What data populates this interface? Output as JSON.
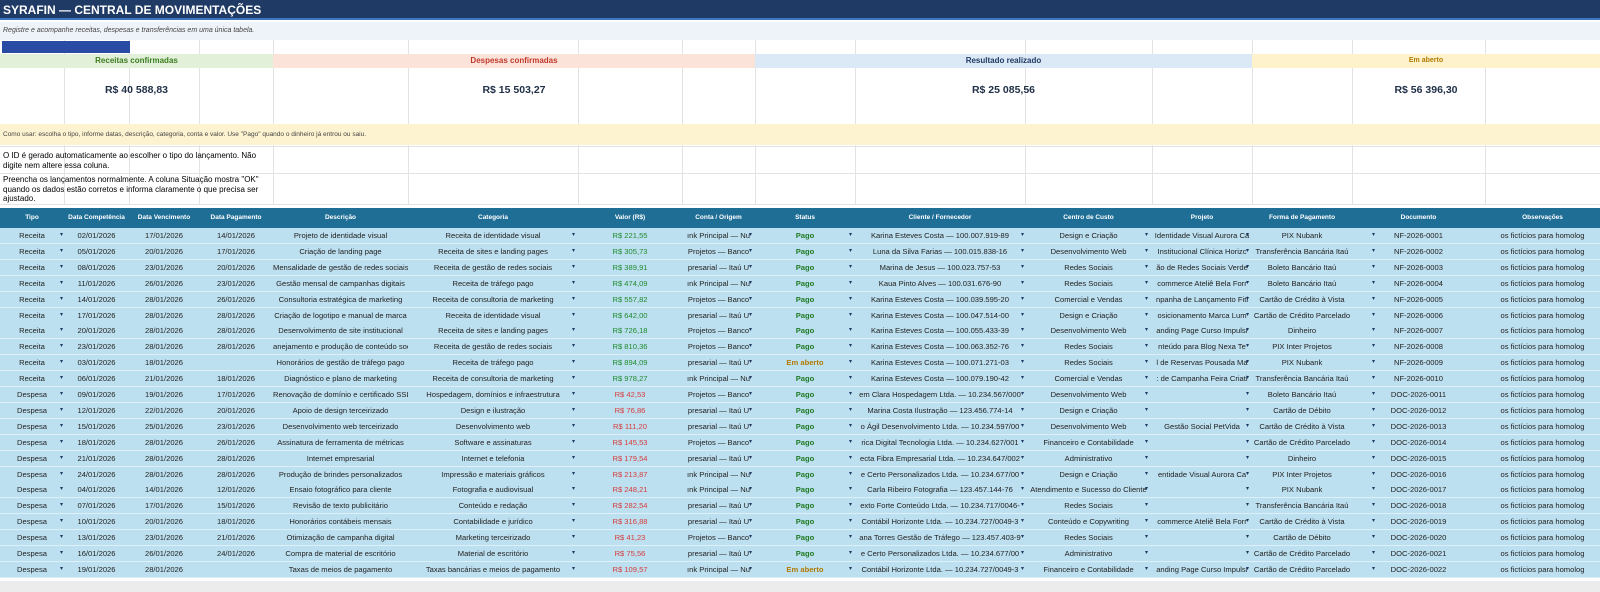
{
  "title": "SYRAFIN — CENTRAL DE MOVIMENTAÇÕES",
  "subtitle": "Registre e acompanhe receitas, despesas e transferências em uma única tabela.",
  "kpis": [
    {
      "label": "Receitas confirmadas",
      "value": "R$ 40 588,83",
      "bg": "#e2f0d9",
      "color": "#3a7d1e"
    },
    {
      "label": "Despesas confirmadas",
      "value": "R$ 15 503,27",
      "bg": "#fbe3da",
      "color": "#c0392b"
    },
    {
      "label": "Resultado realizado",
      "value": "R$ 25 085,56",
      "bg": "#dbe8f5",
      "color": "#1f3a64"
    },
    {
      "label": "Em aberto",
      "value": "R$ 56 396,30",
      "bg": "#fdf2cc",
      "color": "#b07b00"
    }
  ],
  "note": "Como usar: escolha o tipo, informe datas, descrição, categoria, conta e valor. Use \"Pago\" quando o dinheiro já entrou ou saiu.",
  "help1": "O ID é gerado automaticamente ao escolher o tipo do lançamento. Não digite nem altere essa coluna.",
  "help2": "Preencha os lançamentos normalmente. A coluna Situação mostra \"OK\" quando os dados estão corretos e informa claramente o que precisa ser ajustado.",
  "headers": [
    "Tipo",
    "Data Competência",
    "Data Vencimento",
    "Data Pagamento",
    "Descrição",
    "Categoria",
    "Valor (R$)",
    "Conta / Origem",
    "Status",
    "Cliente / Fornecedor",
    "Centro de Custo",
    "Projeto",
    "Forma de Pagamento",
    "Documento",
    "Observações"
  ],
  "rows": [
    [
      "Receita",
      "02/01/2026",
      "17/01/2026",
      "14/01/2026",
      "Projeto de identidade visual",
      "Receita de identidade visual",
      "R$ 221,55",
      "ınk Principal — Nu",
      "Pago",
      "Karina Esteves Costa — 100.007.919-89",
      "Design e Criação",
      "Identidade Visual Aurora Ca",
      "PIX Nubank",
      "NF-2026-0001",
      "os fictícios para homolog"
    ],
    [
      "Receita",
      "05/01/2026",
      "20/01/2026",
      "17/01/2026",
      "Criação de landing page",
      "Receita de sites e landing pages",
      "R$ 305,73",
      "Projetos — Banco",
      "Pago",
      "Luna da Silva Farias — 100.015.838-16",
      "Desenvolvimento Web",
      "Institucional Clínica Horizc",
      "Transferência Bancária Itaú",
      "NF-2026-0002",
      "os fictícios para homolog"
    ],
    [
      "Receita",
      "08/01/2026",
      "23/01/2026",
      "20/01/2026",
      "Mensalidade de gestão de redes sociais",
      "Receita de gestão de redes sociais",
      "R$ 389,91",
      "presarial — Itaú U",
      "Pago",
      "Marina de Jesus — 100.023.757-53",
      "Redes Sociais",
      "ão de Redes Sociais Verde",
      "Boleto Bancário Itaú",
      "NF-2026-0003",
      "os fictícios para homolog"
    ],
    [
      "Receita",
      "11/01/2026",
      "26/01/2026",
      "23/01/2026",
      "Gestão mensal de campanhas digitais",
      "Receita de tráfego pago",
      "R$ 474,09",
      "ınk Principal — Nu",
      "Pago",
      "Kaua Pinto Alves — 100.031.676-90",
      "Redes Sociais",
      "commerce Ateliê Bela Forr",
      "Boleto Bancário Itaú",
      "NF-2026-0004",
      "os fictícios para homolog"
    ],
    [
      "Receita",
      "14/01/2026",
      "28/01/2026",
      "26/01/2026",
      "Consultoria estratégica de marketing",
      "Receita de consultoria de marketing",
      "R$ 557,82",
      "Projetos — Banco",
      "Pago",
      "Karina Esteves Costa — 100.039.595-20",
      "Comercial e Vendas",
      "npanha de Lançamento Fitl",
      "Cartão de Crédito à Vista",
      "NF-2026-0005",
      "os fictícios para homolog"
    ],
    [
      "Receita",
      "17/01/2026",
      "28/01/2026",
      "28/01/2026",
      "Criação de logotipo e manual de marca",
      "Receita de identidade visual",
      "R$ 642,00",
      "presarial — Itaú U",
      "Pago",
      "Karina Esteves Costa — 100.047.514-00",
      "Design e Criação",
      "osicionamento Marca Lum",
      "Cartão de Crédito Parcelado",
      "NF-2026-0006",
      "os fictícios para homolog"
    ],
    [
      "Receita",
      "20/01/2026",
      "28/01/2026",
      "28/01/2026",
      "Desenvolvimento de site institucional",
      "Receita de sites e landing pages",
      "R$ 726,18",
      "Projetos — Banco",
      "Pago",
      "Karina Esteves Costa — 100.055.433-39",
      "Desenvolvimento Web",
      "anding Page Curso Impulsı",
      "Dinheiro",
      "NF-2026-0007",
      "os fictícios para homolog"
    ],
    [
      "Receita",
      "23/01/2026",
      "28/01/2026",
      "28/01/2026",
      "anejamento e produção de conteúdo soci",
      "Receita de gestão de redes sociais",
      "R$ 810,36",
      "Projetos — Banco",
      "Pago",
      "Karina Esteves Costa — 100.063.352-76",
      "Redes Sociais",
      "nteúdo para Blog Nexa Te",
      "PIX Inter Projetos",
      "NF-2026-0008",
      "os fictícios para homolog"
    ],
    [
      "Receita",
      "03/01/2026",
      "18/01/2026",
      "",
      "Honorários de gestão de tráfego pago",
      "Receita de tráfego pago",
      "R$ 894,09",
      "presarial — Itaú U",
      "Em aberto",
      "Karina Esteves Costa — 100.071.271-03",
      "Redes Sociais",
      "l de Reservas Pousada Ma",
      "PIX Nubank",
      "NF-2026-0009",
      "os fictícios para homolog"
    ],
    [
      "Receita",
      "06/01/2026",
      "21/01/2026",
      "18/01/2026",
      "Diagnóstico e plano de marketing",
      "Receita de consultoria de marketing",
      "R$ 978,27",
      "ınk Principal — Nu",
      "Pago",
      "Karina Esteves Costa — 100.079.190-42",
      "Comercial e Vendas",
      ": de Campanha Feira Criati",
      "Transferência Bancária Itaú",
      "NF-2026-0010",
      "os fictícios para homolog"
    ],
    [
      "Despesa",
      "09/01/2026",
      "19/01/2026",
      "17/01/2026",
      "Renovação de domínio e certificado SSL",
      "Hospedagem, domínios e infraestrutura",
      "R$ 42,53",
      "Projetos — Banco",
      "Pago",
      "em Clara Hospedagem Ltda. — 10.234.567/000",
      "Desenvolvimento Web",
      "",
      "Boleto Bancário Itaú",
      "DOC-2026-0011",
      "os fictícios para homolog"
    ],
    [
      "Despesa",
      "12/01/2026",
      "22/01/2026",
      "20/01/2026",
      "Apoio de design terceirizado",
      "Design e ilustração",
      "R$ 76,86",
      "presarial — Itaú U",
      "Pago",
      "Marina Costa Ilustração — 123.456.774-14",
      "Design e Criação",
      "",
      "Cartão de Débito",
      "DOC-2026-0012",
      "os fictícios para homolog"
    ],
    [
      "Despesa",
      "15/01/2026",
      "25/01/2026",
      "23/01/2026",
      "Desenvolvimento web terceirizado",
      "Desenvolvimento web",
      "R$ 111,20",
      "presarial — Itaú U",
      "Pago",
      "o Ágil Desenvolvimento Ltda. — 10.234.597/00",
      "Desenvolvimento Web",
      "Gestão Social PetVida",
      "Cartão de Crédito à Vista",
      "DOC-2026-0013",
      "os fictícios para homolog"
    ],
    [
      "Despesa",
      "18/01/2026",
      "28/01/2026",
      "26/01/2026",
      "Assinatura de ferramenta de métricas",
      "Software e assinaturas",
      "R$ 145,53",
      "Projetos — Banco",
      "Pago",
      "rica Digital Tecnologia Ltda. — 10.234.627/001",
      "Financeiro e Contabilidade",
      "",
      "Cartão de Crédito Parcelado",
      "DOC-2026-0014",
      "os fictícios para homolog"
    ],
    [
      "Despesa",
      "21/01/2026",
      "28/01/2026",
      "28/01/2026",
      "Internet empresarial",
      "Internet e telefonia",
      "R$ 179,54",
      "presarial — Itaú U",
      "Pago",
      "ecta Fibra Empresarial Ltda. — 10.234.647/002",
      "Administrativo",
      "",
      "Dinheiro",
      "DOC-2026-0015",
      "os fictícios para homolog"
    ],
    [
      "Despesa",
      "24/01/2026",
      "28/01/2026",
      "28/01/2026",
      "Produção de brindes personalizados",
      "Impressão e materiais gráficos",
      "R$ 213,87",
      "ınk Principal — Nu",
      "Pago",
      "e Certo Personalizados Ltda. — 10.234.677/00",
      "Design e Criação",
      "entidade Visual Aurora Ca",
      "PIX Inter Projetos",
      "DOC-2026-0016",
      "os fictícios para homolog"
    ],
    [
      "Despesa",
      "04/01/2026",
      "14/01/2026",
      "12/01/2026",
      "Ensaio fotográfico para cliente",
      "Fotografia e audiovisual",
      "R$ 248,21",
      "ınk Principal — Nu",
      "Pago",
      "Carla Ribeiro Fotografia — 123.457.144-76",
      "Atendimento e Sucesso do Cliente",
      "",
      "PIX Nubank",
      "DOC-2026-0017",
      "os fictícios para homolog"
    ],
    [
      "Despesa",
      "07/01/2026",
      "17/01/2026",
      "15/01/2026",
      "Revisão de texto publicitário",
      "Conteúdo e redação",
      "R$ 282,54",
      "presarial — Itaú U",
      "Pago",
      "exto Forte Conteúdo Ltda. — 10.234.717/0046-",
      "Redes Sociais",
      "",
      "Transferência Bancária Itaú",
      "DOC-2026-0018",
      "os fictícios para homolog"
    ],
    [
      "Despesa",
      "10/01/2026",
      "20/01/2026",
      "18/01/2026",
      "Honorários contábeis mensais",
      "Contabilidade e jurídico",
      "R$ 316,88",
      "presarial — Itaú U",
      "Pago",
      "Contábil Horizonte Ltda. — 10.234.727/0049-3",
      "Conteúdo e Copywriting",
      "commerce Ateliê Bela Forr",
      "Cartão de Crédito à Vista",
      "DOC-2026-0019",
      "os fictícios para homolog"
    ],
    [
      "Despesa",
      "13/01/2026",
      "23/01/2026",
      "21/01/2026",
      "Otimização de campanha digital",
      "Marketing terceirizado",
      "R$ 41,23",
      "Projetos — Banco",
      "Pago",
      "ana Torres Gestão de Tráfego — 123.457.403-9",
      "Redes Sociais",
      "",
      "Cartão de Débito",
      "DOC-2026-0020",
      "os fictícios para homolog"
    ],
    [
      "Despesa",
      "16/01/2026",
      "26/01/2026",
      "24/01/2026",
      "Compra de material de escritório",
      "Material de escritório",
      "R$ 75,56",
      "presarial — Itaú U",
      "Pago",
      "e Certo Personalizados Ltda. — 10.234.677/00",
      "Administrativo",
      "",
      "Cartão de Crédito Parcelado",
      "DOC-2026-0021",
      "os fictícios para homolog"
    ],
    [
      "Despesa",
      "19/01/2026",
      "28/01/2026",
      "",
      "Taxas de meios de pagamento",
      "Taxas bancárias e meios de pagamento",
      "R$ 109,57",
      "ınk Principal — Nu",
      "Em aberto",
      "Contábil Horizonte Ltda. — 10.234.727/0049-3",
      "Financeiro e Contabilidade",
      "anding Page Curso Impulsı",
      "Cartão de Crédito Parcelado",
      "DOC-2026-0022",
      "os fictícios para homolog"
    ]
  ]
}
